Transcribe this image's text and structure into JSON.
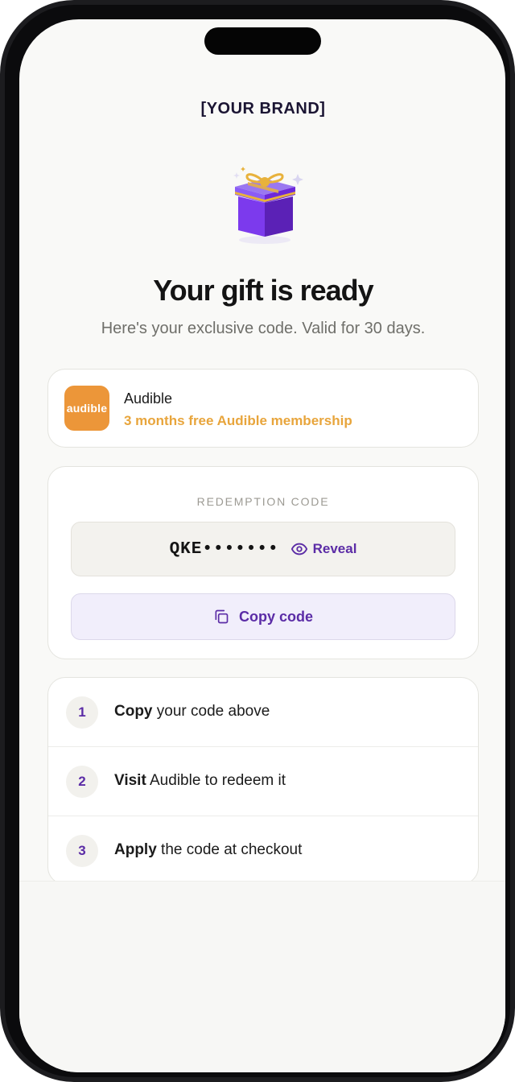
{
  "brand": "[YOUR BRAND]",
  "hero": {
    "title": "Your gift is ready",
    "subtitle": "Here's your exclusive code. Valid for 30 days."
  },
  "offer": {
    "logo_text": "audible",
    "name": "Audible",
    "description": "3 months free Audible membership",
    "logo_color": "#ec9639",
    "accent_color": "#e8a53c"
  },
  "code": {
    "label": "REDEMPTION CODE",
    "masked_value": "QKE•••••••",
    "reveal_label": "Reveal",
    "copy_label": "Copy code"
  },
  "steps": [
    {
      "number": "1",
      "action": "Copy",
      "rest": " your code above"
    },
    {
      "number": "2",
      "action": "Visit",
      "rest": " Audible to redeem it"
    },
    {
      "number": "3",
      "action": "Apply",
      "rest": " the code at checkout"
    }
  ],
  "colors": {
    "primary": "#5b2ca6",
    "gift_box": "#7c3aed",
    "ribbon": "#e8b23c"
  }
}
